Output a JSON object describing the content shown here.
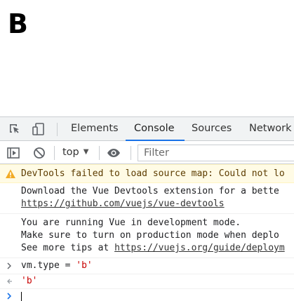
{
  "page": {
    "heading": "B"
  },
  "devtools": {
    "tabs": [
      {
        "label": "Elements",
        "active": false
      },
      {
        "label": "Console",
        "active": true
      },
      {
        "label": "Sources",
        "active": false
      },
      {
        "label": "Network",
        "active": false
      }
    ],
    "toolbar": {
      "context": "top",
      "filter_placeholder": "Filter",
      "filter_value": ""
    },
    "messages": {
      "warning": "DevTools failed to load source map: Could not lo",
      "devtools_info_line1": "Download the Vue Devtools extension for a bette",
      "devtools_info_link": "https://github.com/vuejs/vue-devtools",
      "devmode_line1": "You are running Vue in development mode.",
      "devmode_line2": "Make sure to turn on production mode when deplo",
      "devmode_line3_prefix": "See more tips at ",
      "devmode_line3_link": "https://vuejs.org/guide/deploym",
      "input_expr_prefix": "vm.type = ",
      "input_expr_string": "'b'",
      "result_value": "'b'"
    },
    "colors": {
      "accent": "#1a73e8",
      "warning_bg": "#fffbe5",
      "string": "#c80000"
    }
  }
}
